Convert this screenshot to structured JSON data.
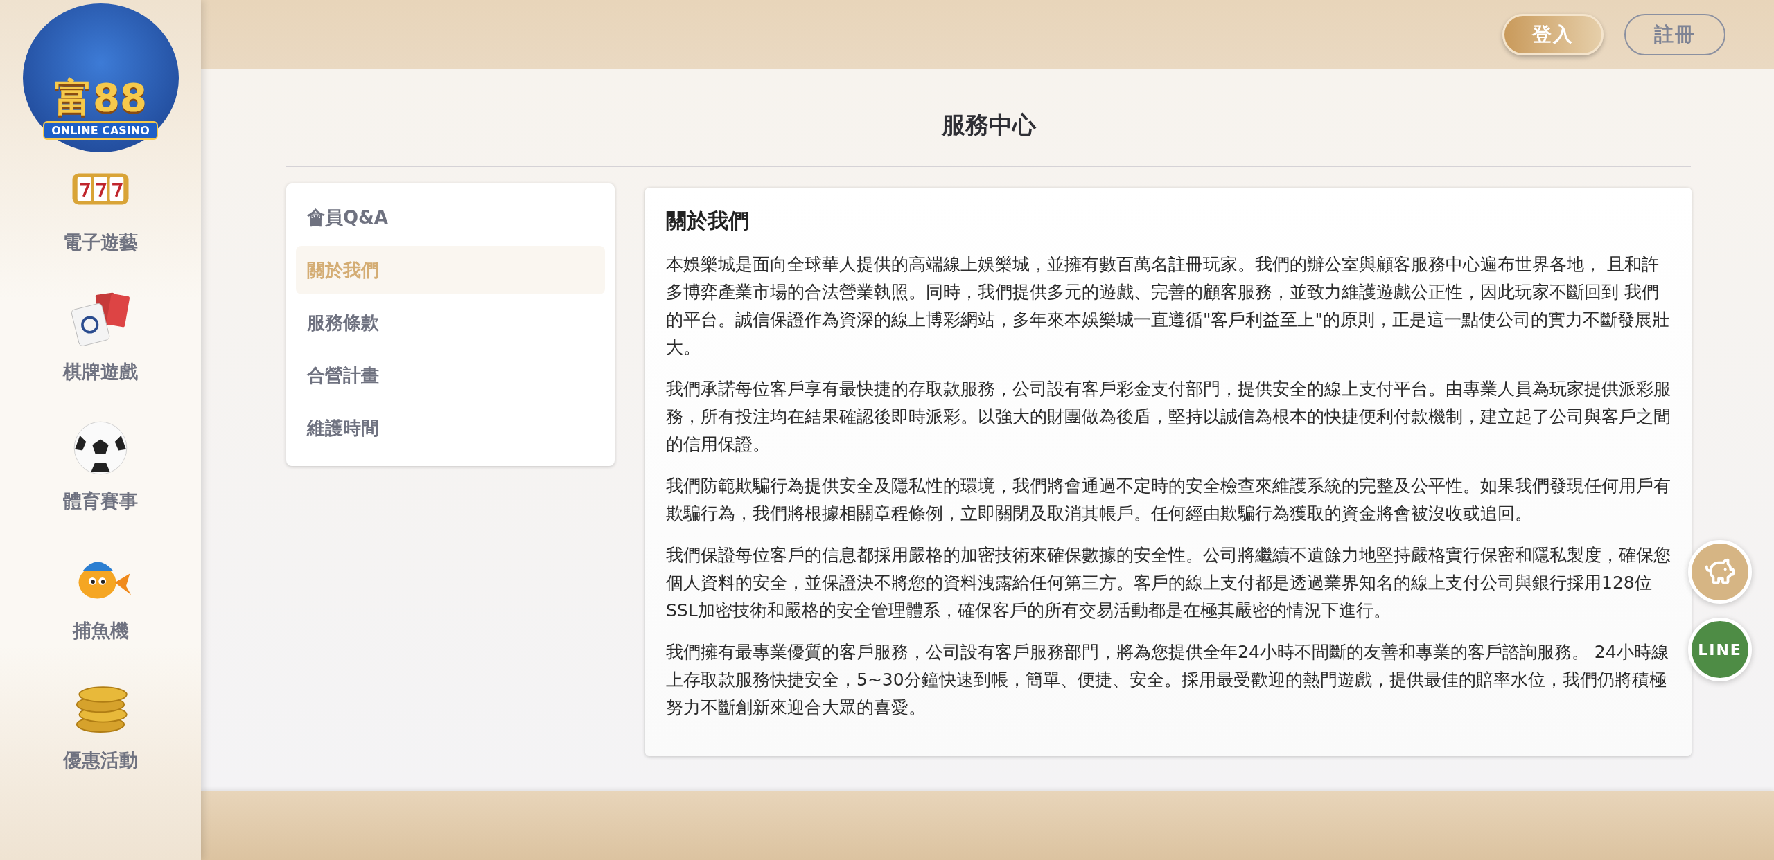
{
  "sidebar": {
    "logo": {
      "name": "富88",
      "tagline": "ONLINE CASINO"
    },
    "items": [
      {
        "label": "電子遊藝",
        "kind": "slots"
      },
      {
        "label": "棋牌遊戲",
        "kind": "cards"
      },
      {
        "label": "體育賽事",
        "kind": "ball"
      },
      {
        "label": "捕魚機",
        "kind": "fish"
      },
      {
        "label": "優惠活動",
        "kind": "coins"
      }
    ]
  },
  "header": {
    "buttons": [
      {
        "label": "登入",
        "kind": "primary"
      },
      {
        "label": "註冊",
        "kind": "outline"
      }
    ]
  },
  "page_title": "服務中心",
  "menu": [
    {
      "label": "會員Q&A",
      "selected": false
    },
    {
      "label": "關於我們",
      "selected": true
    },
    {
      "label": "服務條款",
      "selected": false
    },
    {
      "label": "合營計畫",
      "selected": false
    },
    {
      "label": "維護時間",
      "selected": false
    }
  ],
  "article": {
    "title": "關於我們",
    "paragraphs": [
      "本娛樂城是面向全球華人提供的高端線上娛樂城，並擁有數百萬名註冊玩家。我們的辦公室與顧客服務中心遍布世界各地， 且和許多博弈產業市場的合法營業執照。同時，我們提供多元的遊戲、完善的顧客服務，並致力維護遊戲公正性，因此玩家不斷回到 我們的平台。誠信保證作為資深的線上博彩網站，多年來本娛樂城一直遵循\"客戶利益至上\"的原則，正是這一點使公司的實力不斷發展壯大。",
      "我們承諾每位客戶享有最快捷的存取款服務，公司設有客戶彩金支付部門，提供安全的線上支付平台。由專業人員為玩家提供派彩服務，所有投注均在結果確認後即時派彩。以強大的財團做為後盾，堅持以誠信為根本的快捷便利付款機制，建立起了公司與客戶之間的信用保證。",
      "我們防範欺騙行為提供安全及隱私性的環境，我們將會通過不定時的安全檢查來維護系統的完整及公平性。如果我們發現任何用戶有欺騙行為，我們將根據相關章程條例，立即關閉及取消其帳戶。任何經由欺騙行為獲取的資金將會被沒收或追回。",
      "我們保證每位客戶的信息都採用嚴格的加密技術來確保數據的安全性。公司將繼續不遺餘力地堅持嚴格實行保密和隱私製度，確保您個人資料的安全，並保證決不將您的資料洩露給任何第三方。客戶的線上支付都是透過業界知名的線上支付公司與銀行採用128位SSL加密技術和嚴格的安全管理體系，確保客戶的所有交易活動都是在極其嚴密的情況下進行。",
      "我們擁有最專業優質的客戶服務，公司設有客戶服務部門，將為您提供全年24小時不間斷的友善和專業的客戶諮詢服務。 24小時線上存取款服務快捷安全，5~30分鐘快速到帳，簡單、便捷、安全。採用最受歡迎的熱門遊戲，提供最佳的賠率水位，我們仍將積極努力不斷創新來迎合大眾的喜愛。"
    ]
  },
  "float_buttons": [
    {
      "kind": "piggy"
    },
    {
      "kind": "line",
      "label": "LINE"
    }
  ]
}
